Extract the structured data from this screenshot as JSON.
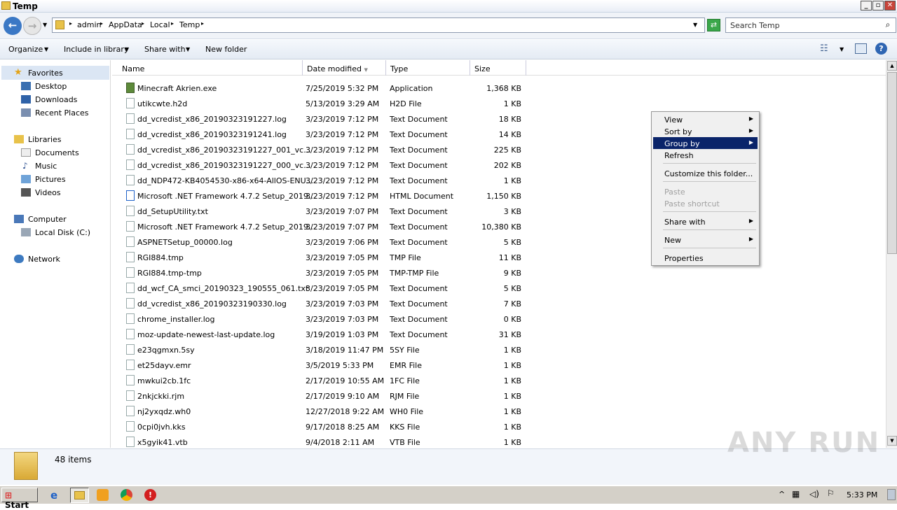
{
  "window": {
    "title": "Temp"
  },
  "address": {
    "crumbs": [
      "admin",
      "AppData",
      "Local",
      "Temp"
    ],
    "search_placeholder": "Search Temp"
  },
  "toolbar": {
    "organize": "Organize",
    "include_in_library": "Include in library",
    "share_with": "Share with",
    "new_folder": "New folder"
  },
  "sidebar": {
    "favorites": "Favorites",
    "desktop": "Desktop",
    "downloads": "Downloads",
    "recent_places": "Recent Places",
    "libraries": "Libraries",
    "documents": "Documents",
    "music": "Music",
    "pictures": "Pictures",
    "videos": "Videos",
    "computer": "Computer",
    "local_disk": "Local Disk (C:)",
    "network": "Network"
  },
  "columns": {
    "name": "Name",
    "date": "Date modified",
    "type": "Type",
    "size": "Size"
  },
  "files": [
    {
      "name": "Minecraft Akrien.exe",
      "date": "7/25/2019 5:32 PM",
      "type": "Application",
      "size": "1,368 KB",
      "icon": "minecraft-icon"
    },
    {
      "name": "utikcwte.h2d",
      "date": "5/13/2019 3:29 AM",
      "type": "H2D File",
      "size": "1 KB",
      "icon": "file-icon"
    },
    {
      "name": "dd_vcredist_x86_20190323191227.log",
      "date": "3/23/2019 7:12 PM",
      "type": "Text Document",
      "size": "18 KB",
      "icon": "text-file-icon"
    },
    {
      "name": "dd_vcredist_x86_20190323191241.log",
      "date": "3/23/2019 7:12 PM",
      "type": "Text Document",
      "size": "14 KB",
      "icon": "text-file-icon"
    },
    {
      "name": "dd_vcredist_x86_20190323191227_001_vc...",
      "date": "3/23/2019 7:12 PM",
      "type": "Text Document",
      "size": "225 KB",
      "icon": "text-file-icon"
    },
    {
      "name": "dd_vcredist_x86_20190323191227_000_vc...",
      "date": "3/23/2019 7:12 PM",
      "type": "Text Document",
      "size": "202 KB",
      "icon": "text-file-icon"
    },
    {
      "name": "dd_NDP472-KB4054530-x86-x64-AllOS-ENU...",
      "date": "3/23/2019 7:12 PM",
      "type": "Text Document",
      "size": "1 KB",
      "icon": "text-file-icon"
    },
    {
      "name": "Microsoft .NET Framework 4.7.2 Setup_2019...",
      "date": "3/23/2019 7:12 PM",
      "type": "HTML Document",
      "size": "1,150 KB",
      "icon": "ie-html-icon"
    },
    {
      "name": "dd_SetupUtility.txt",
      "date": "3/23/2019 7:07 PM",
      "type": "Text Document",
      "size": "3 KB",
      "icon": "text-file-icon"
    },
    {
      "name": "Microsoft .NET Framework 4.7.2 Setup_2019...",
      "date": "3/23/2019 7:07 PM",
      "type": "Text Document",
      "size": "10,380 KB",
      "icon": "text-file-icon"
    },
    {
      "name": "ASPNETSetup_00000.log",
      "date": "3/23/2019 7:06 PM",
      "type": "Text Document",
      "size": "5 KB",
      "icon": "text-file-icon"
    },
    {
      "name": "RGI884.tmp",
      "date": "3/23/2019 7:05 PM",
      "type": "TMP File",
      "size": "11 KB",
      "icon": "file-icon"
    },
    {
      "name": "RGI884.tmp-tmp",
      "date": "3/23/2019 7:05 PM",
      "type": "TMP-TMP File",
      "size": "9 KB",
      "icon": "file-icon"
    },
    {
      "name": "dd_wcf_CA_smci_20190323_190555_061.txt",
      "date": "3/23/2019 7:05 PM",
      "type": "Text Document",
      "size": "5 KB",
      "icon": "text-file-icon"
    },
    {
      "name": "dd_vcredist_x86_20190323190330.log",
      "date": "3/23/2019 7:03 PM",
      "type": "Text Document",
      "size": "7 KB",
      "icon": "text-file-icon"
    },
    {
      "name": "chrome_installer.log",
      "date": "3/23/2019 7:03 PM",
      "type": "Text Document",
      "size": "0 KB",
      "icon": "text-file-icon"
    },
    {
      "name": "moz-update-newest-last-update.log",
      "date": "3/19/2019 1:03 PM",
      "type": "Text Document",
      "size": "31 KB",
      "icon": "text-file-icon"
    },
    {
      "name": "e23qgmxn.5sy",
      "date": "3/18/2019 11:47 PM",
      "type": "5SY File",
      "size": "1 KB",
      "icon": "file-icon"
    },
    {
      "name": "et25dayv.emr",
      "date": "3/5/2019 5:33 PM",
      "type": "EMR File",
      "size": "1 KB",
      "icon": "file-icon"
    },
    {
      "name": "mwkui2cb.1fc",
      "date": "2/17/2019 10:55 AM",
      "type": "1FC File",
      "size": "1 KB",
      "icon": "file-icon"
    },
    {
      "name": "2nkjckki.rjm",
      "date": "2/17/2019 9:10 AM",
      "type": "RJM File",
      "size": "1 KB",
      "icon": "file-icon"
    },
    {
      "name": "nj2yxqdz.wh0",
      "date": "12/27/2018 9:22 AM",
      "type": "WH0 File",
      "size": "1 KB",
      "icon": "file-icon"
    },
    {
      "name": "0cpi0jvh.kks",
      "date": "9/17/2018 8:25 AM",
      "type": "KKS File",
      "size": "1 KB",
      "icon": "file-icon"
    },
    {
      "name": "x5gyik41.vtb",
      "date": "9/4/2018 2:11 AM",
      "type": "VTB File",
      "size": "1 KB",
      "icon": "file-icon"
    }
  ],
  "context_menu": {
    "view": "View",
    "sort_by": "Sort by",
    "group_by": "Group by",
    "refresh": "Refresh",
    "customize": "Customize this folder...",
    "paste": "Paste",
    "paste_shortcut": "Paste shortcut",
    "share_with": "Share with",
    "new": "New",
    "properties": "Properties"
  },
  "status": {
    "count": "48 items"
  },
  "taskbar": {
    "start": "Start",
    "clock": "5:33 PM"
  },
  "watermark": "ANY RUN"
}
